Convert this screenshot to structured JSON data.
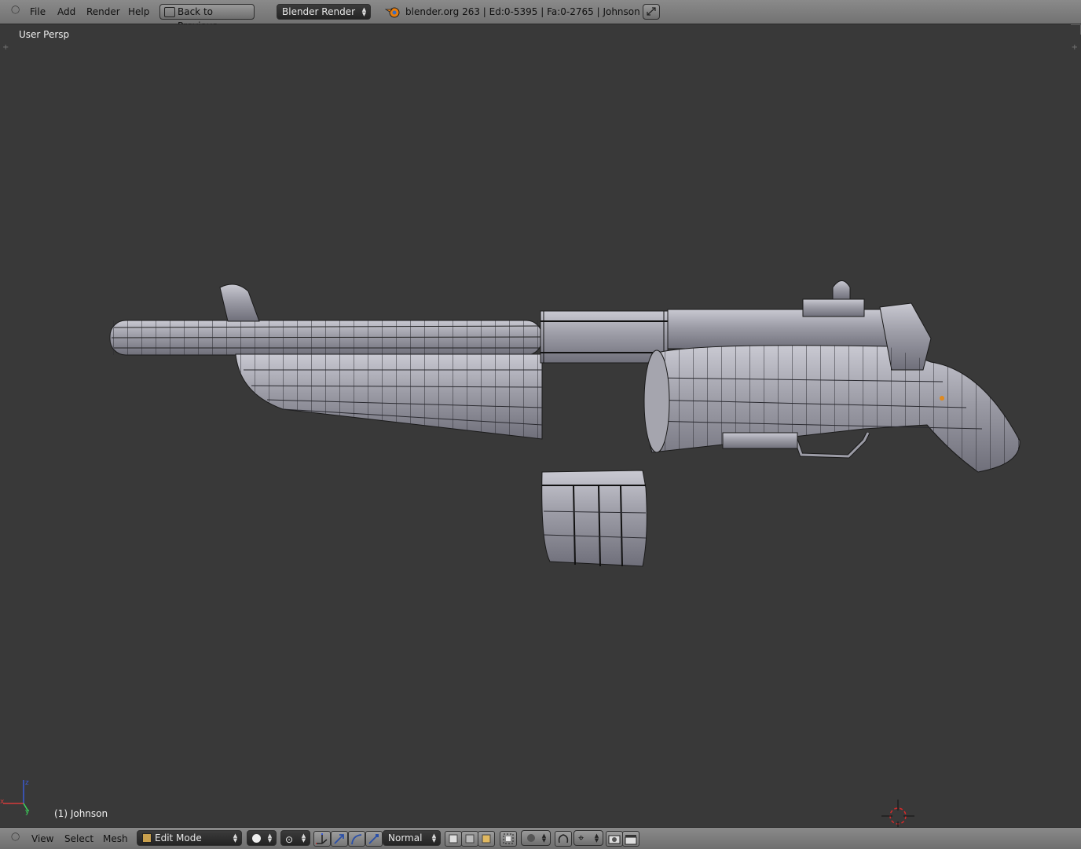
{
  "menu": {
    "file": "File",
    "add": "Add",
    "render": "Render",
    "help": "Help"
  },
  "header": {
    "back_label": "Back to Previous",
    "engine": "Blender Render",
    "stats": "blender.org 263 | Ed:0-5395 | Fa:0-2765 | Johnson"
  },
  "viewport": {
    "view_name": "User Persp",
    "object_label": "(1) Johnson"
  },
  "footer": {
    "view": "View",
    "select": "Select",
    "mesh": "Mesh",
    "mode": "Edit Mode",
    "orientation": "Normal"
  },
  "colors": {
    "background": "#393939",
    "mesh_fill": "#9a9aa4",
    "wire": "#1a1a1a",
    "accent": "#e08a1e"
  },
  "icons": [
    "blender-logo-icon",
    "maximize-icon",
    "axis-gizmo-icon",
    "3d-cursor-icon"
  ]
}
